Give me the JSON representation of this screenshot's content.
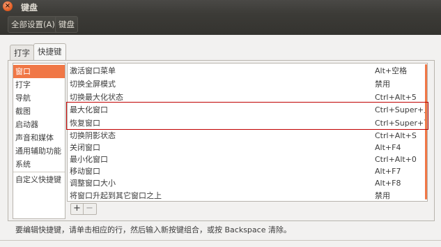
{
  "window": {
    "title": "键盘"
  },
  "toolbar": {
    "all_settings": "全部设置(A)",
    "keyboard": "键盘"
  },
  "tabs": [
    {
      "label": "打字",
      "active": false
    },
    {
      "label": "快捷键",
      "active": true
    }
  ],
  "categories": [
    {
      "label": "窗口",
      "selected": true
    },
    {
      "label": "打字",
      "selected": false
    },
    {
      "label": "导航",
      "selected": false
    },
    {
      "label": "截图",
      "selected": false
    },
    {
      "label": "启动器",
      "selected": false
    },
    {
      "label": "声音和媒体",
      "selected": false
    },
    {
      "label": "通用辅助功能",
      "selected": false
    },
    {
      "label": "系统",
      "selected": false
    },
    {
      "label": "自定义快捷键",
      "selected": false
    }
  ],
  "shortcuts": [
    {
      "name": "激活窗口菜单",
      "key": "Alt+空格"
    },
    {
      "name": "切换全屏模式",
      "key": "禁用"
    },
    {
      "name": "切换最大化状态",
      "key": "Ctrl+Alt+5"
    },
    {
      "name": "最大化窗口",
      "key": "Ctrl+Super+上"
    },
    {
      "name": "恢复窗口",
      "key": "Ctrl+Super+下"
    },
    {
      "name": "切换阴影状态",
      "key": "Ctrl+Alt+S"
    },
    {
      "name": "关闭窗口",
      "key": "Alt+F4"
    },
    {
      "name": "最小化窗口",
      "key": "Ctrl+Alt+0"
    },
    {
      "name": "移动窗口",
      "key": "Alt+F7"
    },
    {
      "name": "调整窗口大小",
      "key": "Alt+F8"
    },
    {
      "name": "将窗口升起到其它窗口之上",
      "key": "禁用"
    }
  ],
  "buttons": {
    "add": "+",
    "remove": "−"
  },
  "hint": "要编辑快捷键，请单击相应的行，然后输入新按键组合，或按 Backspace 清除。",
  "colors": {
    "accent": "#f07746",
    "highlight_border": "#c00000",
    "titlebar": "#3c3b37"
  }
}
